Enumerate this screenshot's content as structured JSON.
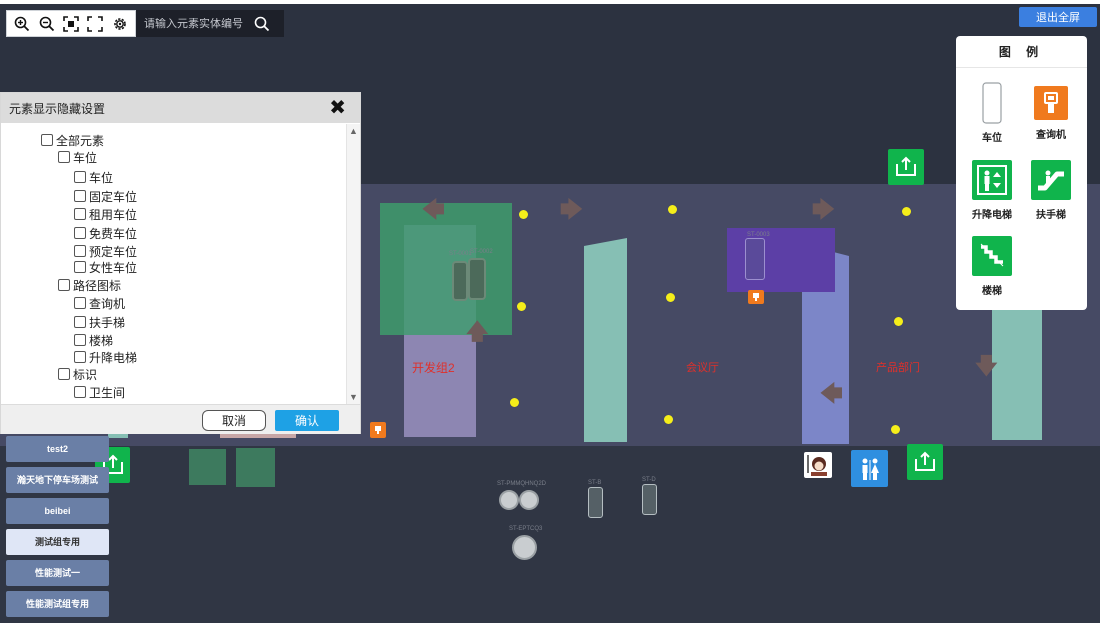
{
  "toolbar": {
    "icons": [
      "zoom-in-icon",
      "zoom-out-icon",
      "fit-screen-icon",
      "fullscreen-icon",
      "gear-icon"
    ],
    "search_placeholder": "请输入元素实体编号"
  },
  "exit_fullscreen_label": "退出全屏",
  "legend": {
    "title": "图 例",
    "items": [
      {
        "label": "车位",
        "icon": "parking-space-icon"
      },
      {
        "label": "查询机",
        "icon": "kiosk-icon"
      },
      {
        "label": "升降电梯",
        "icon": "elevator-icon"
      },
      {
        "label": "扶手梯",
        "icon": "escalator-icon"
      },
      {
        "label": "楼梯",
        "icon": "stairs-icon"
      }
    ]
  },
  "panel": {
    "title": "元素显示隐藏设置",
    "tree": [
      {
        "label": "全部元素",
        "level": 0
      },
      {
        "label": "车位",
        "level": 1
      },
      {
        "label": "车位",
        "level": 2
      },
      {
        "label": "固定车位",
        "level": 2
      },
      {
        "label": "租用车位",
        "level": 2
      },
      {
        "label": "免费车位",
        "level": 2
      },
      {
        "label": "预定车位",
        "level": 2
      },
      {
        "label": "女性车位",
        "level": 2
      },
      {
        "label": "路径图标",
        "level": 1
      },
      {
        "label": "查询机",
        "level": 2
      },
      {
        "label": "扶手梯",
        "level": 2
      },
      {
        "label": "楼梯",
        "level": 2
      },
      {
        "label": "升降电梯",
        "level": 2
      },
      {
        "label": "标识",
        "level": 1
      },
      {
        "label": "卫生间",
        "level": 2
      }
    ],
    "cancel_label": "取消",
    "confirm_label": "确认"
  },
  "floors": [
    {
      "label": "test2",
      "active": false
    },
    {
      "label": "瀚天地下停车场测试",
      "active": false
    },
    {
      "label": "beibei",
      "active": false
    },
    {
      "label": "测试组专用",
      "active": true
    },
    {
      "label": "性能测试一",
      "active": false
    },
    {
      "label": "性能测试组专用",
      "active": false
    }
  ],
  "map": {
    "zone_labels": [
      "开发组2",
      "会议厅",
      "产品部门"
    ],
    "small_labels": [
      "ST-0001",
      "ST-0002",
      "ST-0003",
      "ST-PMMQHNQ2D",
      "ST-B",
      "ST-D",
      "ST-EPTCQ3"
    ]
  },
  "colors": {
    "background": "#2c3240",
    "map_band": "#464a64",
    "accent_blue": "#3b7fe0",
    "confirm_blue": "#1ea1e5",
    "icon_green": "#10b44c",
    "icon_orange": "#f07a1e",
    "zone_label_red": "#e0302a"
  }
}
